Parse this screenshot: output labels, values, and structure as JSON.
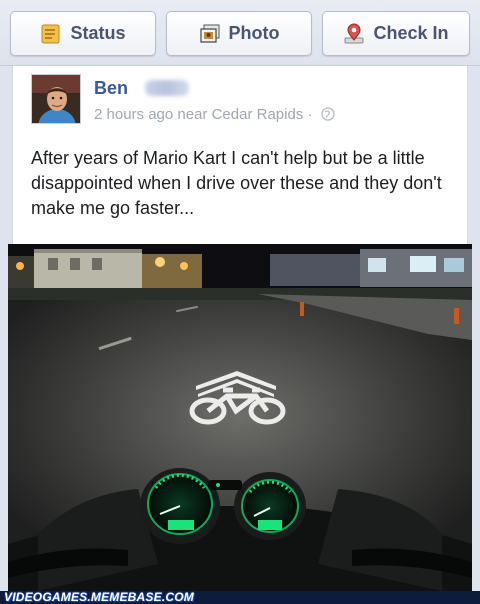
{
  "toolbar": {
    "status_label": "Status",
    "photo_label": "Photo",
    "checkin_label": "Check In"
  },
  "post": {
    "author": "Ben",
    "time": "2 hours ago",
    "location_text": "near Cedar Rapids",
    "separator": "·",
    "text": "After years of Mario Kart I can't help but be a little disappointed when I drive over these and they don't make me go faster..."
  },
  "watermark": {
    "text": "VIDEOGAMES.MEMEBASE.COM"
  },
  "colors": {
    "link_blue": "#3b5998",
    "meta_gray": "#a0a6b4",
    "gauge_green": "#19e37a"
  }
}
